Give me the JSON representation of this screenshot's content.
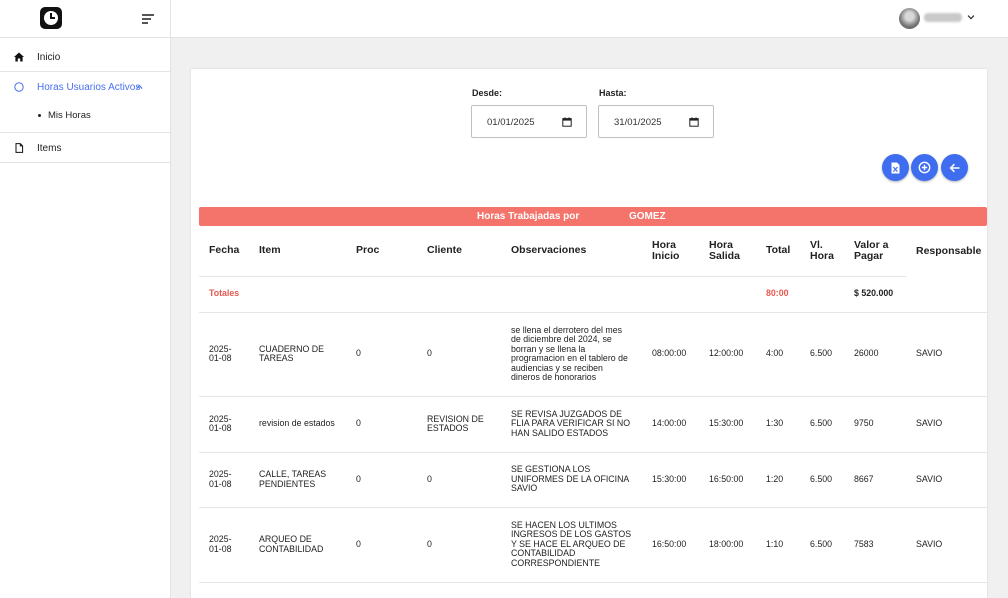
{
  "sidebar": {
    "items": [
      {
        "label": "Inicio",
        "icon": "home-icon"
      },
      {
        "label": "Horas Usuarios Activos",
        "icon": "circle-icon",
        "active": true,
        "expanded": true
      },
      {
        "label": "Items",
        "icon": "document-icon"
      }
    ],
    "sub_items": [
      {
        "label": "Mis Horas"
      }
    ]
  },
  "filters": {
    "from": {
      "label": "Desde:",
      "value": "01/01/2025"
    },
    "to": {
      "label": "Hasta:",
      "value": "31/01/2025"
    }
  },
  "actions": [
    {
      "icon": "excel-file-icon"
    },
    {
      "icon": "add-circle-icon"
    },
    {
      "icon": "arrow-left-icon"
    }
  ],
  "banner": {
    "prefix": "Horas Trabajadas por",
    "name": "GOMEZ"
  },
  "table": {
    "headers": [
      "Fecha",
      "Item",
      "Proc",
      "Cliente",
      "Observaciones",
      "Hora Inicio",
      "Hora Salida",
      "Total",
      "Vl. Hora",
      "Valor a Pagar",
      "Responsable"
    ],
    "totals": {
      "label": "Totales",
      "total": "80:00",
      "valor": "$ 520.000"
    },
    "rows": [
      {
        "fecha": "2025-01-08",
        "item": "CUADERNO DE TAREAS",
        "proc": "0",
        "cliente": "0",
        "obs": "se llena el derrotero del mes de diciembre del 2024, se borran y se llena la programacion en el tablero de audiencias y se reciben dineros de honorarios",
        "inicio": "08:00:00",
        "salida": "12:00:00",
        "total": "4:00",
        "vl_hora": "6.500",
        "valor": "26000",
        "responsable": "SAVIO"
      },
      {
        "fecha": "2025-01-08",
        "item": "revision de estados",
        "proc": "0",
        "cliente": "REVISION DE ESTADOS",
        "obs": "SE REVISA JUZGADOS DE FLIA PARA VERIFICAR SI NO HAN SALIDO ESTADOS",
        "inicio": "14:00:00",
        "salida": "15:30:00",
        "total": "1:30",
        "vl_hora": "6.500",
        "valor": "9750",
        "responsable": "SAVIO"
      },
      {
        "fecha": "2025-01-08",
        "item": "CALLE, TAREAS PENDIENTES",
        "proc": "0",
        "cliente": "0",
        "obs": "SE GESTIONA LOS UNIFORMES DE LA OFICINA SAVIO",
        "inicio": "15:30:00",
        "salida": "16:50:00",
        "total": "1:20",
        "vl_hora": "6.500",
        "valor": "8667",
        "responsable": "SAVIO"
      },
      {
        "fecha": "2025-01-08",
        "item": "ARQUEO DE CONTABILIDAD",
        "proc": "0",
        "cliente": "0",
        "obs": "SE HACEN LOS ULTIMOS INGRESOS DE LOS GASTOS Y SE HACE EL ARQUEO DE CONTABILIDAD CORRESPONDIENTE",
        "inicio": "16:50:00",
        "salida": "18:00:00",
        "total": "1:10",
        "vl_hora": "6.500",
        "valor": "7583",
        "responsable": "SAVIO"
      }
    ]
  },
  "colors": {
    "accent": "#3f6df0",
    "active_nav": "#4a6ff0",
    "banner": "#f4736a",
    "totals_text": "#e5584e"
  }
}
